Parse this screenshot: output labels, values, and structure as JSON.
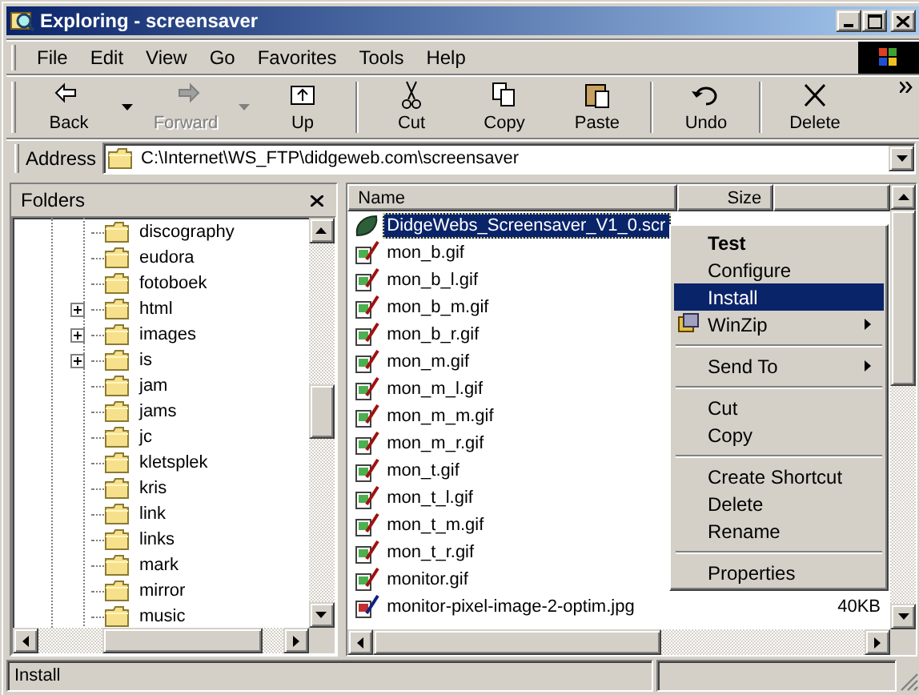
{
  "window": {
    "title": "Exploring - screensaver"
  },
  "menu_bar": [
    {
      "label": "File"
    },
    {
      "label": "Edit"
    },
    {
      "label": "View"
    },
    {
      "label": "Go"
    },
    {
      "label": "Favorites"
    },
    {
      "label": "Tools"
    },
    {
      "label": "Help"
    }
  ],
  "toolbar": [
    [
      {
        "label": "Back",
        "kind": "back",
        "disabled": false,
        "dropdown": true
      },
      {
        "label": "Forward",
        "kind": "forward",
        "disabled": true,
        "dropdown": true
      },
      {
        "label": "Up",
        "kind": "up",
        "disabled": false,
        "dropdown": false
      }
    ],
    [
      {
        "label": "Cut",
        "kind": "cut",
        "disabled": false,
        "dropdown": false
      },
      {
        "label": "Copy",
        "kind": "copy",
        "disabled": false,
        "dropdown": false
      },
      {
        "label": "Paste",
        "kind": "paste",
        "disabled": false,
        "dropdown": false
      }
    ],
    [
      {
        "label": "Undo",
        "kind": "undo",
        "disabled": false,
        "dropdown": false
      }
    ],
    [
      {
        "label": "Delete",
        "kind": "delete",
        "disabled": false,
        "dropdown": false
      }
    ]
  ],
  "address": {
    "label": "Address",
    "value": "C:\\Internet\\WS_FTP\\didgeweb.com\\screensaver"
  },
  "folders": {
    "title": "Folders",
    "items": [
      {
        "name": "discography",
        "expandable": false
      },
      {
        "name": "eudora",
        "expandable": false
      },
      {
        "name": "fotoboek",
        "expandable": false
      },
      {
        "name": "html",
        "expandable": true
      },
      {
        "name": "images",
        "expandable": true
      },
      {
        "name": "is",
        "expandable": true
      },
      {
        "name": "jam",
        "expandable": false
      },
      {
        "name": "jams",
        "expandable": false
      },
      {
        "name": "jc",
        "expandable": false
      },
      {
        "name": "kletsplek",
        "expandable": false
      },
      {
        "name": "kris",
        "expandable": false
      },
      {
        "name": "link",
        "expandable": false
      },
      {
        "name": "links",
        "expandable": false
      },
      {
        "name": "mark",
        "expandable": false
      },
      {
        "name": "mirror",
        "expandable": false
      },
      {
        "name": "music",
        "expandable": false
      }
    ]
  },
  "files": {
    "columns": [
      "Name",
      "Size"
    ],
    "rows": [
      {
        "name": "DidgeWebs_Screensaver_V1_0.scr",
        "kind": "scr",
        "selected": true
      },
      {
        "name": "mon_b.gif",
        "kind": "gif",
        "selected": false
      },
      {
        "name": "mon_b_l.gif",
        "kind": "gif",
        "selected": false
      },
      {
        "name": "mon_b_m.gif",
        "kind": "gif",
        "selected": false
      },
      {
        "name": "mon_b_r.gif",
        "kind": "gif",
        "selected": false
      },
      {
        "name": "mon_m.gif",
        "kind": "gif",
        "selected": false
      },
      {
        "name": "mon_m_l.gif",
        "kind": "gif",
        "selected": false
      },
      {
        "name": "mon_m_m.gif",
        "kind": "gif",
        "selected": false
      },
      {
        "name": "mon_m_r.gif",
        "kind": "gif",
        "selected": false
      },
      {
        "name": "mon_t.gif",
        "kind": "gif",
        "selected": false
      },
      {
        "name": "mon_t_l.gif",
        "kind": "gif",
        "selected": false
      },
      {
        "name": "mon_t_m.gif",
        "kind": "gif",
        "selected": false
      },
      {
        "name": "mon_t_r.gif",
        "kind": "gif",
        "selected": false
      },
      {
        "name": "monitor.gif",
        "kind": "gif",
        "selected": false
      },
      {
        "name": "monitor-pixel-image-2-optim.jpg",
        "kind": "jpg",
        "size": "40KB",
        "selected": false
      }
    ]
  },
  "context_menu": {
    "items": [
      {
        "kind": "item",
        "label": "Test",
        "default": true,
        "selected": false,
        "submenu": false,
        "has_icon": false
      },
      {
        "kind": "item",
        "label": "Configure",
        "default": false,
        "selected": false,
        "submenu": false,
        "has_icon": false
      },
      {
        "kind": "item",
        "label": "Install",
        "default": false,
        "selected": true,
        "submenu": false,
        "has_icon": false
      },
      {
        "kind": "item",
        "label": "WinZip",
        "default": false,
        "selected": false,
        "submenu": true,
        "has_icon": true
      },
      {
        "kind": "separator"
      },
      {
        "kind": "item",
        "label": "Send To",
        "default": false,
        "selected": false,
        "submenu": true,
        "has_icon": false
      },
      {
        "kind": "separator"
      },
      {
        "kind": "item",
        "label": "Cut",
        "default": false,
        "selected": false,
        "submenu": false,
        "has_icon": false
      },
      {
        "kind": "item",
        "label": "Copy",
        "default": false,
        "selected": false,
        "submenu": false,
        "has_icon": false
      },
      {
        "kind": "separator"
      },
      {
        "kind": "item",
        "label": "Create Shortcut",
        "default": false,
        "selected": false,
        "submenu": false,
        "has_icon": false
      },
      {
        "kind": "item",
        "label": "Delete",
        "default": false,
        "selected": false,
        "submenu": false,
        "has_icon": false
      },
      {
        "kind": "item",
        "label": "Rename",
        "default": false,
        "selected": false,
        "submenu": false,
        "has_icon": false
      },
      {
        "kind": "separator"
      },
      {
        "kind": "item",
        "label": "Properties",
        "default": false,
        "selected": false,
        "submenu": false,
        "has_icon": false
      }
    ]
  },
  "status_bar": {
    "text": "Install"
  }
}
